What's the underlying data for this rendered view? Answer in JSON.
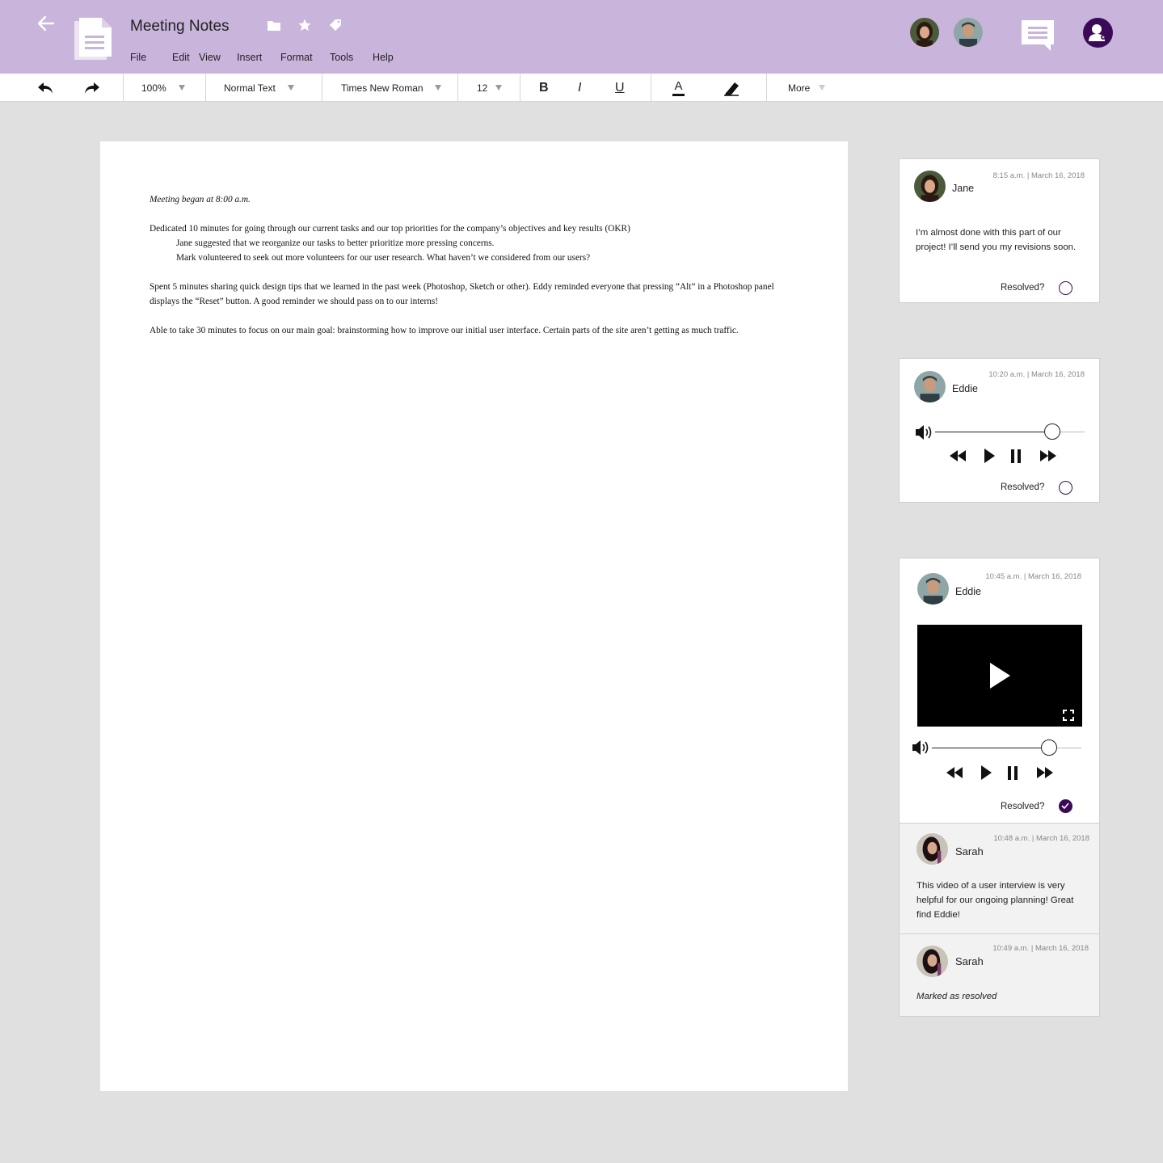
{
  "header": {
    "title": "Meeting Notes",
    "menu": [
      "File",
      "Edit",
      "View",
      "Insert",
      "Format",
      "Tools",
      "Help"
    ],
    "bg_color": "#c9b4db",
    "accent_color": "#3b0a57"
  },
  "toolbar": {
    "zoom": "100%",
    "style": "Normal Text",
    "font": "Times New Roman",
    "font_size": "12",
    "bold": "B",
    "italic": "I",
    "underline": "U",
    "text_color": "A",
    "more": "More"
  },
  "document": {
    "line1": "Meeting began at 8:00 a.m.",
    "para2": "Dedicated 10 minutes for going through our current tasks and our top priorities for the company’s objectives and key results (OKR)",
    "para2_sub1": "Jane suggested that we reorganize our tasks to better prioritize more pressing concerns.",
    "para2_sub2": "Mark volunteered to seek out more volunteers for our user research. What haven’t we considered from our users?",
    "para3": "Spent 5 minutes sharing quick design tips that we learned in the past week (Photoshop, Sketch or other). Eddy reminded everyone that pressing “Alt” in a Photoshop panel displays the “Reset” button. A good reminder we should pass on to our interns!",
    "para4": "Able to take 30 minutes to focus on our main goal: brainstorming how to improve our initial user interface. Certain parts of the site aren’t getting as much traffic."
  },
  "comments": [
    {
      "name": "Jane",
      "time": "8:15 a.m. | March 16, 2018",
      "text": "I’m almost done with this part of our project! I’ll send you my revisions soon.",
      "resolved_label": "Resolved?",
      "resolved": false
    },
    {
      "name": "Eddie",
      "time": "10:20 a.m. | March 16, 2018",
      "audio_progress": 0.85,
      "resolved_label": "Resolved?",
      "resolved": false
    },
    {
      "name": "Eddie",
      "time": "10:45 a.m. | March 16, 2018",
      "video_progress": 0.8,
      "resolved_label": "Resolved?",
      "resolved": true
    }
  ],
  "replies": [
    {
      "name": "Sarah",
      "time": "10:48 a.m. | March 16, 2018",
      "text": "This video of a user interview is very helpful for our ongoing planning! Great find Eddie!"
    },
    {
      "name": "Sarah",
      "time": "10:49 a.m. | March 16, 2018",
      "text": "Marked as resolved"
    }
  ]
}
